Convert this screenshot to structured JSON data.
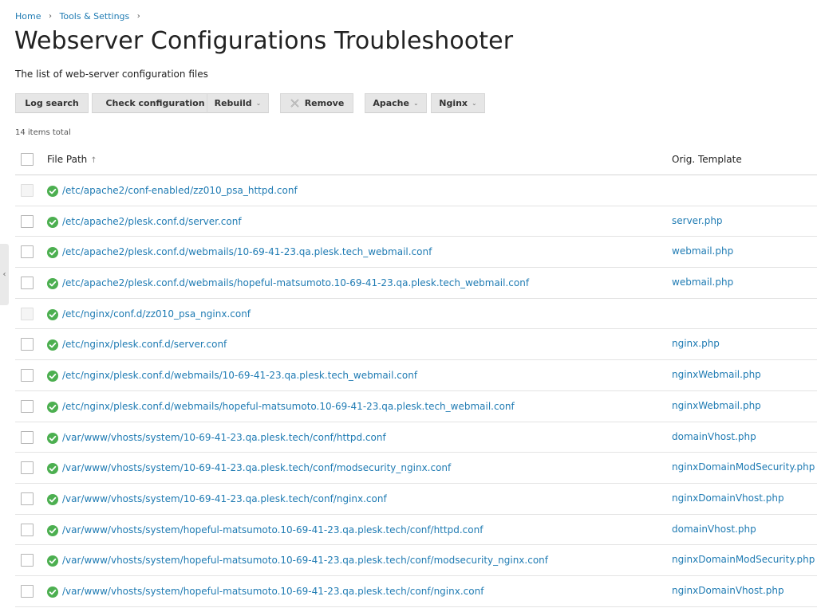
{
  "breadcrumb": {
    "home": "Home",
    "tools": "Tools & Settings",
    "sep": "›"
  },
  "page": {
    "title": "Webserver Configurations Troubleshooter",
    "description": "The list of web-server configuration files"
  },
  "toolbar": {
    "log_search": "Log search",
    "check_configuration": "Check configuration",
    "rebuild": "Rebuild",
    "remove": "Remove",
    "apache": "Apache",
    "nginx": "Nginx",
    "caret": "⌄"
  },
  "items_total": "14 items total",
  "table": {
    "col_file_path": "File Path",
    "sort_glyph": "↑",
    "col_orig_template": "Orig. Template",
    "rows": [
      {
        "path": "/etc/apache2/conf-enabled/zz010_psa_httpd.conf",
        "template": "",
        "selectable": false
      },
      {
        "path": "/etc/apache2/plesk.conf.d/server.conf",
        "template": "server.php",
        "selectable": true
      },
      {
        "path": "/etc/apache2/plesk.conf.d/webmails/10-69-41-23.qa.plesk.tech_webmail.conf",
        "template": "webmail.php",
        "selectable": true
      },
      {
        "path": "/etc/apache2/plesk.conf.d/webmails/hopeful-matsumoto.10-69-41-23.qa.plesk.tech_webmail.conf",
        "template": "webmail.php",
        "selectable": true
      },
      {
        "path": "/etc/nginx/conf.d/zz010_psa_nginx.conf",
        "template": "",
        "selectable": false
      },
      {
        "path": "/etc/nginx/plesk.conf.d/server.conf",
        "template": "nginx.php",
        "selectable": true
      },
      {
        "path": "/etc/nginx/plesk.conf.d/webmails/10-69-41-23.qa.plesk.tech_webmail.conf",
        "template": "nginxWebmail.php",
        "selectable": true
      },
      {
        "path": "/etc/nginx/plesk.conf.d/webmails/hopeful-matsumoto.10-69-41-23.qa.plesk.tech_webmail.conf",
        "template": "nginxWebmail.php",
        "selectable": true
      },
      {
        "path": "/var/www/vhosts/system/10-69-41-23.qa.plesk.tech/conf/httpd.conf",
        "template": "domainVhost.php",
        "selectable": true
      },
      {
        "path": "/var/www/vhosts/system/10-69-41-23.qa.plesk.tech/conf/modsecurity_nginx.conf",
        "template": "nginxDomainModSecurity.php",
        "selectable": true
      },
      {
        "path": "/var/www/vhosts/system/10-69-41-23.qa.plesk.tech/conf/nginx.conf",
        "template": "nginxDomainVhost.php",
        "selectable": true
      },
      {
        "path": "/var/www/vhosts/system/hopeful-matsumoto.10-69-41-23.qa.plesk.tech/conf/httpd.conf",
        "template": "domainVhost.php",
        "selectable": true
      },
      {
        "path": "/var/www/vhosts/system/hopeful-matsumoto.10-69-41-23.qa.plesk.tech/conf/modsecurity_nginx.conf",
        "template": "nginxDomainModSecurity.php",
        "selectable": true
      },
      {
        "path": "/var/www/vhosts/system/hopeful-matsumoto.10-69-41-23.qa.plesk.tech/conf/nginx.conf",
        "template": "nginxDomainVhost.php",
        "selectable": true
      }
    ]
  },
  "side_toggle": "‹",
  "icons": {
    "status": "check-circle-icon",
    "remove": "x-icon",
    "side": "chevron-left-icon"
  },
  "colors": {
    "link": "#1f7bb3",
    "ok": "#4caf50",
    "button_bg": "#e6e6e6"
  }
}
